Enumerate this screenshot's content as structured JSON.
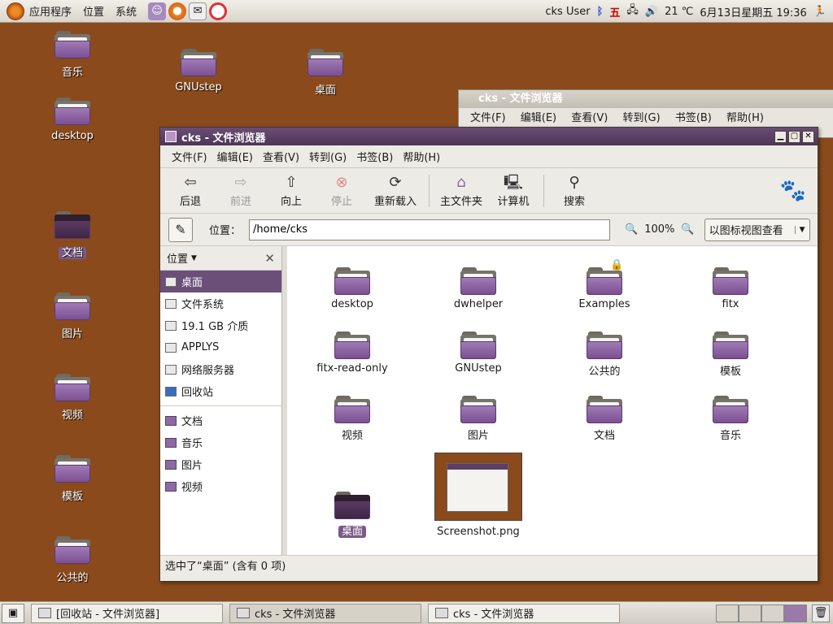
{
  "top_panel": {
    "menus": [
      "应用程序",
      "位置",
      "系统"
    ],
    "user": "cks User",
    "weekday_char": "五",
    "temperature": "21 ℃",
    "datetime": "6月13日星期五 19:36"
  },
  "desktop_icons": [
    {
      "label": "音乐",
      "selected": false
    },
    {
      "label": "desktop",
      "selected": false
    },
    {
      "label": "文档",
      "selected": true
    },
    {
      "label": "图片",
      "selected": false
    },
    {
      "label": "视频",
      "selected": false
    },
    {
      "label": "模板",
      "selected": false
    },
    {
      "label": "公共的",
      "selected": false
    },
    {
      "label": "GNUstep",
      "selected": false
    },
    {
      "label": "桌面",
      "selected": false
    }
  ],
  "bg_window": {
    "title": "cks - 文件浏览器",
    "menus": [
      "文件(F)",
      "编辑(E)",
      "查看(V)",
      "转到(G)",
      "书签(B)",
      "帮助(H)"
    ]
  },
  "window": {
    "title": "cks - 文件浏览器",
    "menus": [
      "文件(F)",
      "编辑(E)",
      "查看(V)",
      "转到(G)",
      "书签(B)",
      "帮助(H)"
    ],
    "toolbar": {
      "back": "后退",
      "forward": "前进",
      "up": "向上",
      "stop": "停止",
      "reload": "重新载入",
      "home": "主文件夹",
      "computer": "计算机",
      "search": "搜索"
    },
    "location_label": "位置：",
    "location_value": "/home/cks",
    "zoom": "100%",
    "view_mode": "以图标视图查看",
    "sidebar_title": "位置",
    "sidebar_places": [
      "桌面",
      "文件系统",
      "19.1 GB 介质",
      "APPLYS",
      "网络服务器",
      "回收站"
    ],
    "sidebar_bookmarks": [
      "文档",
      "音乐",
      "图片",
      "视频"
    ],
    "files": [
      "desktop",
      "dwhelper",
      "Examples",
      "fitx",
      "fitx-read-only",
      "GNUstep",
      "公共的",
      "模板",
      "视频",
      "图片",
      "文档",
      "音乐",
      "桌面",
      "Screenshot.png"
    ],
    "status": "选中了“桌面”  (含有 0 项)"
  },
  "taskbar": {
    "tasks": [
      "[回收站 - 文件浏览器]",
      "cks - 文件浏览器",
      "cks - 文件浏览器"
    ]
  }
}
